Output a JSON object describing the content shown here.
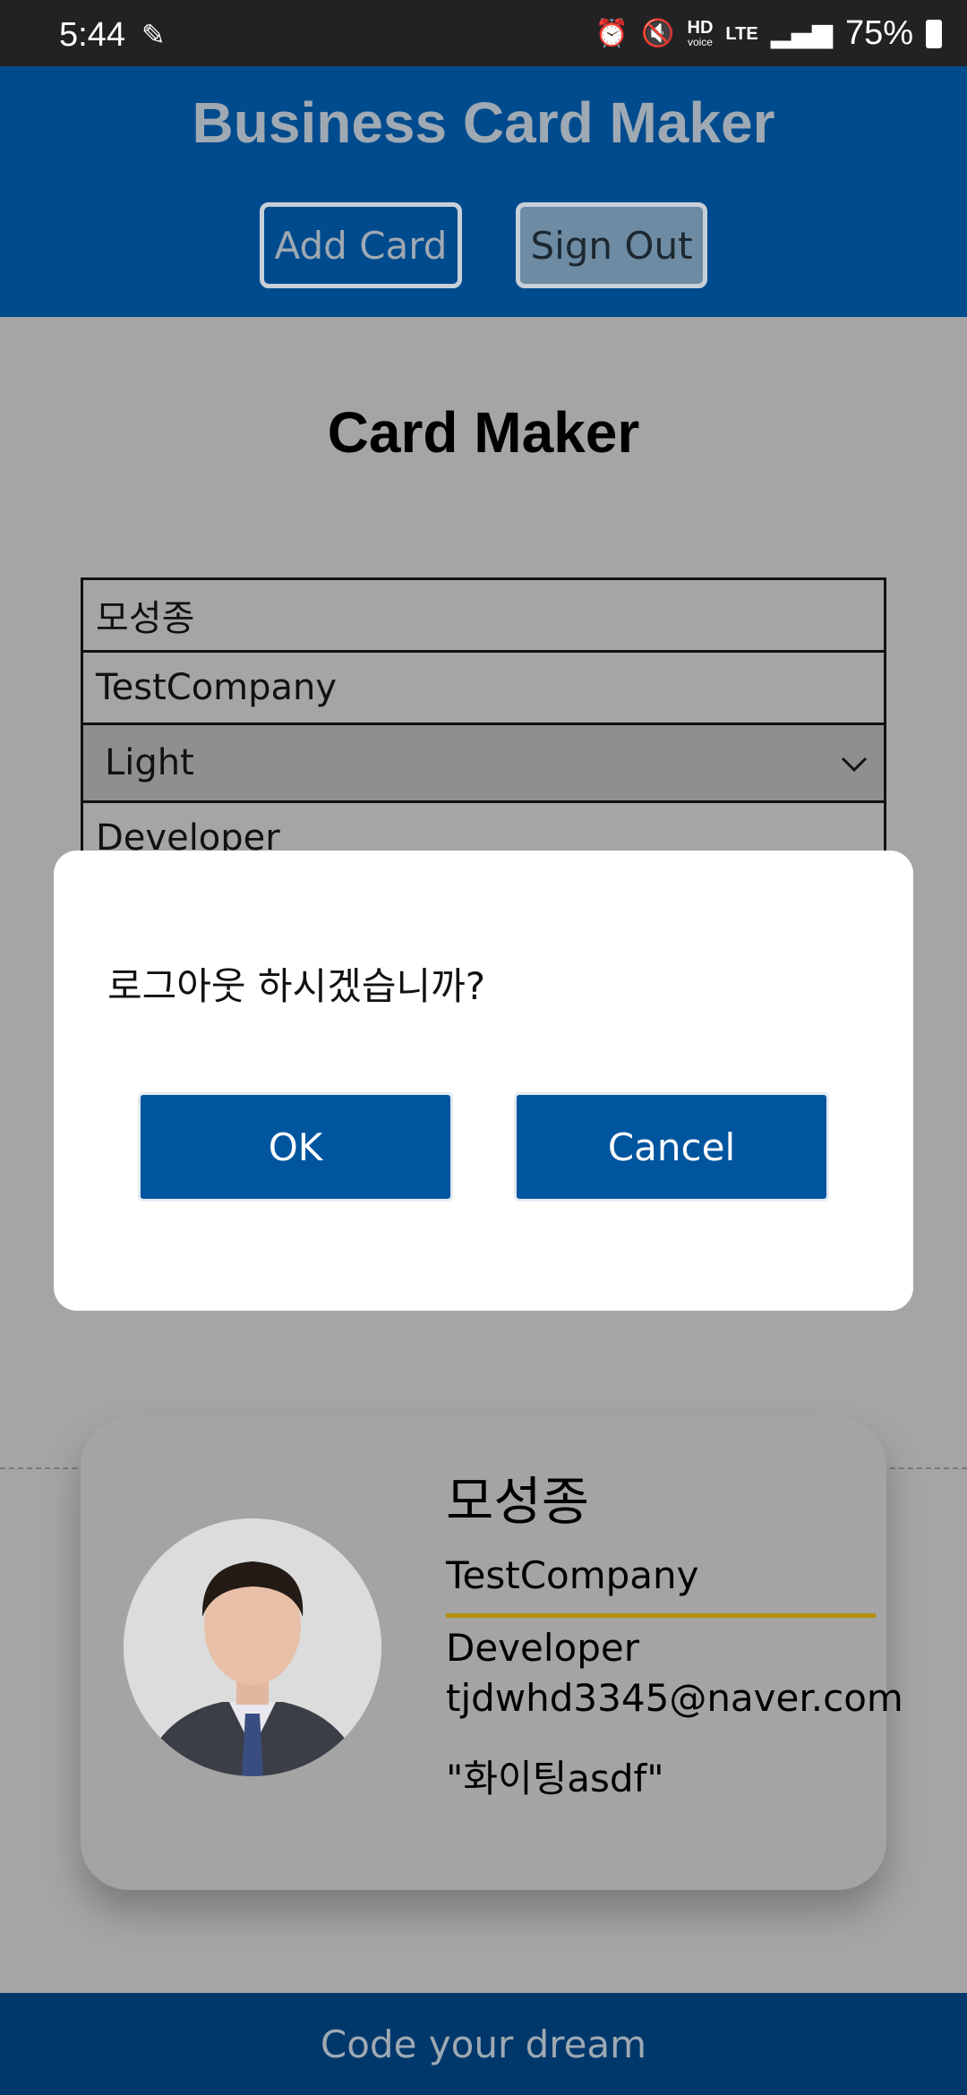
{
  "status_bar": {
    "time": "5:44",
    "battery": "75%",
    "signal_tag_top": "HD",
    "signal_tag_bottom": "voice",
    "network": "LTE"
  },
  "header": {
    "title": "Business Card Maker",
    "add_card_label": "Add Card",
    "sign_out_label": "Sign Out"
  },
  "main": {
    "title": "Card Maker",
    "form": {
      "name": "모성종",
      "company": "TestCompany",
      "theme": "Light",
      "title": "Developer"
    }
  },
  "card": {
    "name": "모성종",
    "company": "TestCompany",
    "title": "Developer",
    "email": "tjdwhd3345@naver.com",
    "message": "\"화이팅asdf\""
  },
  "footer": {
    "text": "Code your dream"
  },
  "dialog": {
    "message": "로그아웃 하시겠습니까?",
    "ok_label": "OK",
    "cancel_label": "Cancel"
  },
  "colors": {
    "header_bg": "#004b8d",
    "footer_bg": "#00386b",
    "dialog_button": "#00559f",
    "accent_line": "#b48f0c"
  },
  "icons": [
    "dolphin-icon",
    "alarm-icon",
    "mute-icon",
    "signal-icon",
    "battery-icon",
    "chevron-down-icon"
  ]
}
